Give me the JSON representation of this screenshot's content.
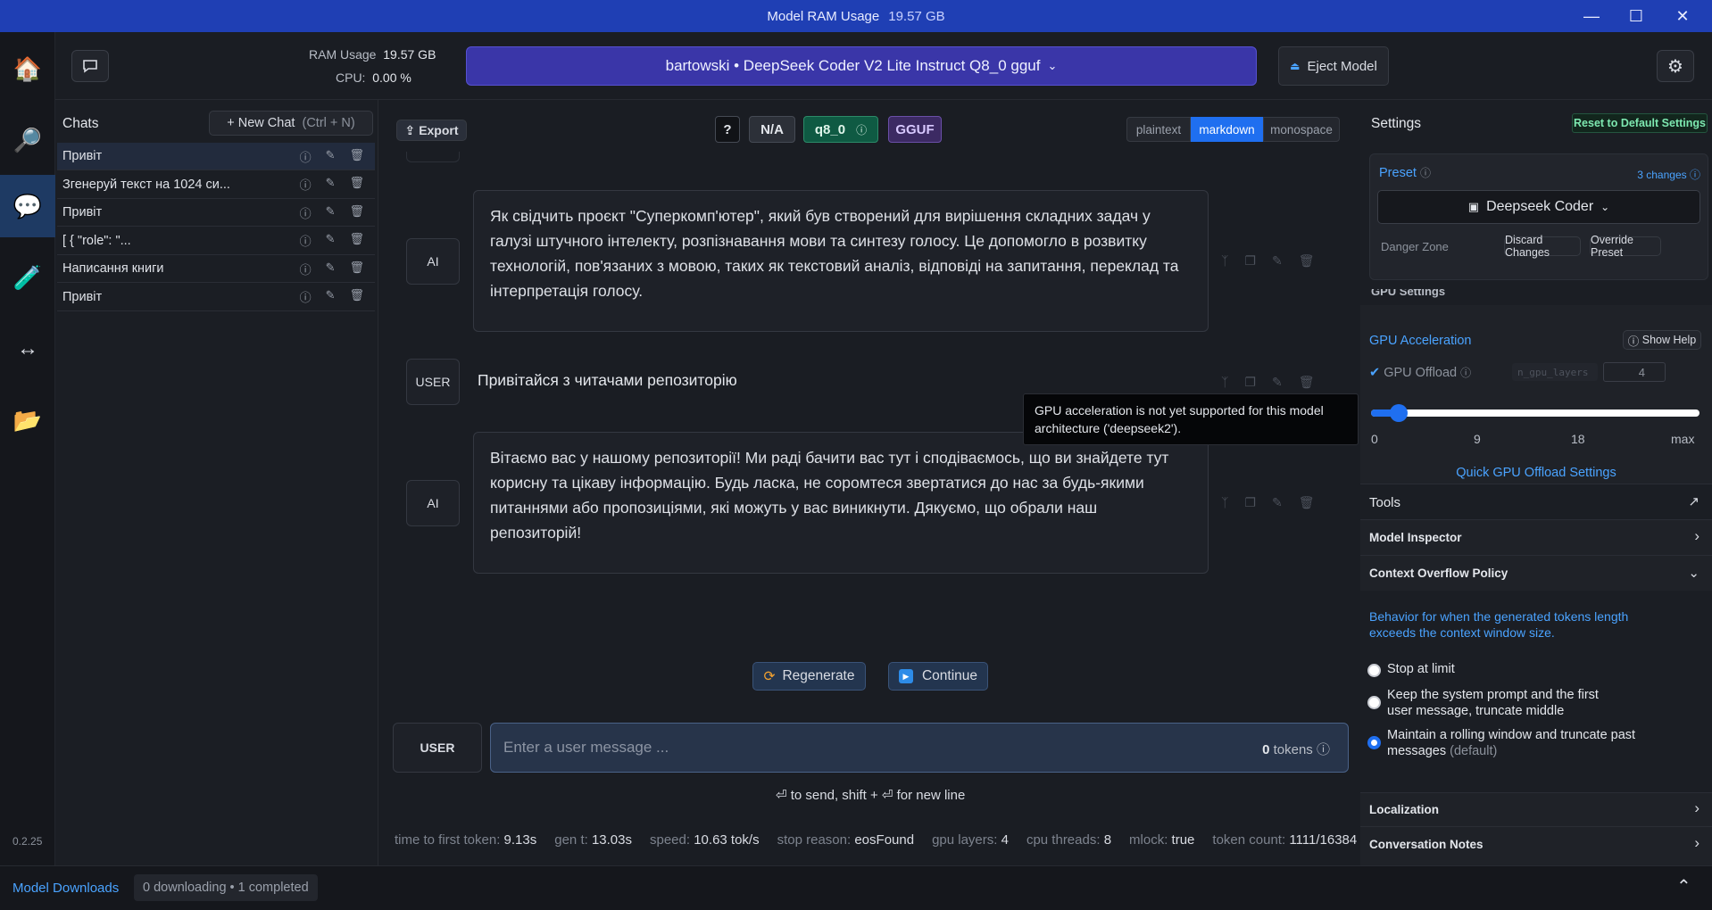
{
  "titlebar": {
    "title": "Model RAM Usage",
    "ram": "19.57 GB"
  },
  "rail": {
    "items": [
      {
        "name": "home-icon",
        "glyph": "🏠"
      },
      {
        "name": "search-icon",
        "glyph": "🔎"
      },
      {
        "name": "chat-icon",
        "glyph": "💬"
      },
      {
        "name": "lab-icon",
        "glyph": "🧪"
      },
      {
        "name": "arrows-icon",
        "glyph": "↔"
      },
      {
        "name": "folder-icon",
        "glyph": "📂"
      }
    ],
    "version": "0.2.25"
  },
  "topbar": {
    "ram_label": "RAM Usage",
    "ram_value": "19.57 GB",
    "cpu_label": "CPU:",
    "cpu_value": "0.00 %",
    "model_name": "bartowski • DeepSeek Coder V2 Lite Instruct Q8_0 gguf",
    "eject_label": "Eject Model"
  },
  "sidebar": {
    "title": "Chats",
    "new_chat": "+ New Chat",
    "new_chat_shortcut": "(Ctrl + N)",
    "chats": [
      {
        "label": "Привіт"
      },
      {
        "label": "Згенеруй текст на 1024 си..."
      },
      {
        "label": "Привіт"
      },
      {
        "label": "[ { \"role\": \"..."
      },
      {
        "label": "Написання книги"
      },
      {
        "label": "Привіт"
      }
    ]
  },
  "toolbar": {
    "export": "Export",
    "help": "?",
    "na": "N/A",
    "quant": "q8_0",
    "format": "GGUF",
    "modes": [
      "plaintext",
      "markdown",
      "monospace"
    ],
    "active_mode": "markdown"
  },
  "messages": [
    {
      "role": "AI",
      "text": "Як свідчить проєкт \"Суперкомп'ютер\", який був створений для вирішення складних задач у галузі штучного інтелекту, розпізнавання мови та синтезу голосу. Це допомогло в розвитку технологій, пов'язаних з мовою, таких як текстовий аналіз, відповіді на запитання, переклад та інтерпретація голосу."
    },
    {
      "role": "USER",
      "text": "Привітайся з читачами репозиторію"
    },
    {
      "role": "AI",
      "text": "Вітаємо вас у нашому репозиторії! Ми раді бачити вас тут і сподіваємось, що ви знайдете тут корисну та цікаву інформацію. Будь ласка, не соромтеся звертатися до нас за будь-якими питаннями або пропозиціями, які можуть у вас виникнути. Дякуємо, що обрали наш репозиторій!"
    }
  ],
  "actions": {
    "regenerate": "Regenerate",
    "continue": "Continue"
  },
  "input": {
    "role": "USER",
    "placeholder": "Enter a user message ...",
    "tokens": "0",
    "tokens_label": "tokens",
    "hint": "⏎ to send, shift + ⏎ for new line"
  },
  "stats": [
    {
      "label": "time to first token:",
      "value": "9.13s"
    },
    {
      "label": "gen t:",
      "value": "13.03s"
    },
    {
      "label": "speed:",
      "value": "10.63 tok/s"
    },
    {
      "label": "stop reason:",
      "value": "eosFound"
    },
    {
      "label": "gpu layers:",
      "value": "4"
    },
    {
      "label": "cpu threads:",
      "value": "8"
    },
    {
      "label": "mlock:",
      "value": "true"
    },
    {
      "label": "token count:",
      "value": "1111/16384"
    }
  ],
  "tooltip": "GPU acceleration is not yet supported for this model architecture ('deepseek2').",
  "settings": {
    "title": "Settings",
    "reset": "Reset to Default Settings",
    "preset_label": "Preset",
    "changes": "3 changes",
    "preset_value": "Deepseek Coder",
    "danger_zone": "Danger Zone",
    "discard": "Discard Changes",
    "override": "Override Preset",
    "gpu_settings": "GPU Settings",
    "gpu_accel": "GPU Acceleration",
    "show_help": "Show Help",
    "gpu_offload": "GPU Offload",
    "n_gpu_layers": "n_gpu_layers",
    "gpu_layers_value": "4",
    "slider_fraction": 0.08,
    "slider_ticks": [
      "0",
      "9",
      "18",
      "max"
    ],
    "quick_gpu": "Quick GPU Offload Settings",
    "tools": "Tools",
    "model_inspector": "Model Inspector",
    "context_overflow": "Context Overflow Policy",
    "overflow_desc": "Behavior for when the generated tokens length exceeds the context window size.",
    "options": [
      {
        "label": "Stop at limit",
        "selected": false
      },
      {
        "label": "Keep the system prompt and the first user message, truncate middle",
        "selected": false
      },
      {
        "label": "Maintain a rolling window and truncate past messages",
        "suffix": "(default)",
        "selected": true
      }
    ],
    "localization": "Localization",
    "conversation_notes": "Conversation Notes"
  },
  "footer": {
    "downloads": "Model Downloads",
    "status": "0 downloading • 1 completed"
  },
  "colors": {
    "accent": "#1f6ff0",
    "titlebar": "#1f3fb4",
    "model": "#3a36a8",
    "quant": "#0f5a43",
    "gguf": "#3c2a63"
  }
}
